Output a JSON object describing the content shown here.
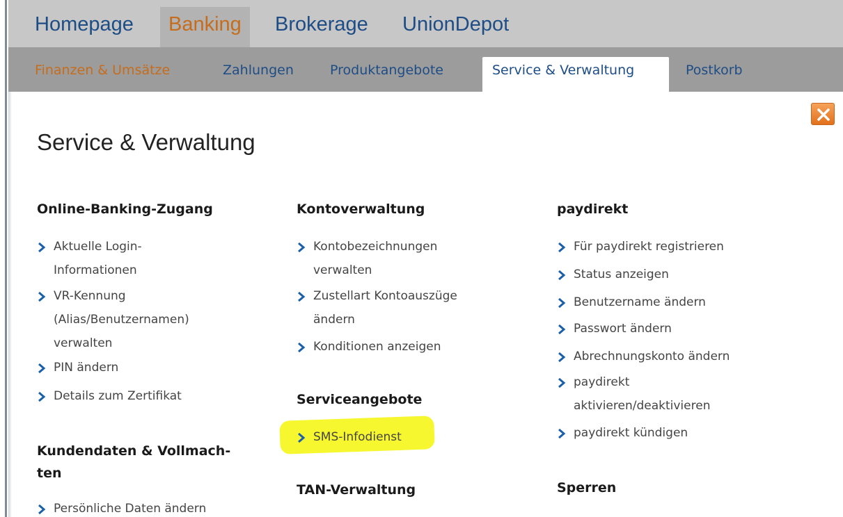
{
  "top_nav": {
    "tabs": [
      {
        "label": "Homepage",
        "active": false
      },
      {
        "label": "Banking",
        "active": true
      },
      {
        "label": "Brokerage",
        "active": false
      },
      {
        "label": "UnionDepot",
        "active": false
      }
    ]
  },
  "sub_nav": {
    "tabs": [
      {
        "label": "Finanzen & Umsätze",
        "active": false
      },
      {
        "label": "Zahlungen",
        "active": false
      },
      {
        "label": "Produktangebote",
        "active": false
      },
      {
        "label": "Service & Verwaltung",
        "active": true
      },
      {
        "label": "Postkorb",
        "active": false
      }
    ]
  },
  "page": {
    "title": "Service & Verwaltung",
    "close_icon": "close-icon"
  },
  "columns": {
    "col1": {
      "sections": [
        {
          "heading": "Online-Banking-Zugang",
          "items": [
            {
              "label": "Aktuelle Login-Informationen",
              "lines": [
                "Aktuelle Login-",
                "Informationen"
              ]
            },
            {
              "label": "VR-Kennung (Alias/Benutzernamen) verwalten",
              "lines": [
                "VR-Kennung",
                "(Alias/Benutzernamen)",
                "verwalten"
              ]
            },
            {
              "label": "PIN ändern",
              "lines": [
                "PIN ändern"
              ]
            },
            {
              "label": "Details zum Zertifikat",
              "lines": [
                "Details zum Zertifikat"
              ]
            }
          ]
        },
        {
          "heading": "Kundendaten & Vollmachten",
          "heading_lines": [
            "Kundendaten & Vollmach-",
            "ten"
          ],
          "items": [
            {
              "label": "Persönliche Daten ändern",
              "lines": [
                "Persönliche Daten ändern"
              ]
            }
          ]
        }
      ]
    },
    "col2": {
      "sections": [
        {
          "heading": "Kontoverwaltung",
          "items": [
            {
              "label": "Kontobezeichnungen verwalten",
              "lines": [
                "Kontobezeichnungen",
                "verwalten"
              ]
            },
            {
              "label": "Zustellart Kontoauszüge ändern",
              "lines": [
                "Zustellart Kontoauszüge",
                "ändern"
              ]
            },
            {
              "label": "Konditionen anzeigen",
              "lines": [
                "Konditionen anzeigen"
              ]
            }
          ]
        },
        {
          "heading": "Serviceangebote",
          "items": [
            {
              "label": "SMS-Infodienst",
              "lines": [
                "SMS-Infodienst"
              ],
              "highlighted": true
            }
          ]
        },
        {
          "heading": "TAN-Verwaltung",
          "items": []
        }
      ]
    },
    "col3": {
      "sections": [
        {
          "heading": "paydirekt",
          "items": [
            {
              "label": "Für paydirekt registrieren",
              "lines": [
                "Für paydirekt registrieren"
              ]
            },
            {
              "label": "Status anzeigen",
              "lines": [
                "Status anzeigen"
              ]
            },
            {
              "label": "Benutzername ändern",
              "lines": [
                "Benutzername ändern"
              ]
            },
            {
              "label": "Passwort ändern",
              "lines": [
                "Passwort ändern"
              ]
            },
            {
              "label": "Abrechnungskonto ändern",
              "lines": [
                "Abrechnungskonto ändern"
              ]
            },
            {
              "label": "paydirekt aktivieren/deaktivieren",
              "lines": [
                "paydirekt",
                "aktivieren/deaktivieren"
              ]
            },
            {
              "label": "paydirekt kündigen",
              "lines": [
                "paydirekt kündigen"
              ]
            }
          ]
        },
        {
          "heading": "Sperren",
          "items": []
        }
      ]
    }
  },
  "colors": {
    "link_blue": "#1e4d86",
    "active_orange": "#c56d1d",
    "chevron_blue": "#1a5fa8",
    "highlight_yellow": "#f7f730"
  }
}
